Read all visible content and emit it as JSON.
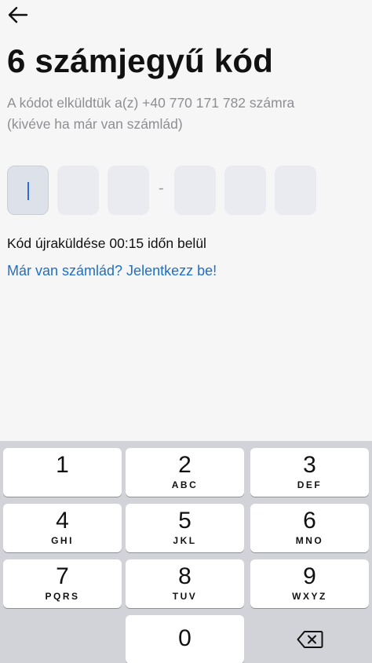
{
  "header": {
    "back_icon": "arrow-left-icon",
    "title": "6 számjegyű kód",
    "subtitle_line1": "A kódot elküldtük a(z) +40 770 171 782 számra",
    "subtitle_line2": "(kivéve ha már van számlád)"
  },
  "code_input": {
    "separator": "-",
    "digits": [
      "",
      "",
      "",
      "",
      "",
      ""
    ],
    "active_index": 0
  },
  "resend_text": "Kód újraküldése 00:15 időn belül",
  "login_link": "Már van számlád? Jelentkezz be!",
  "colors": {
    "accent": "#1f6fc6",
    "caret": "#2b6fd6",
    "background": "#f6f6f7",
    "keypad": "#d1d3d9"
  },
  "keypad": {
    "keys": [
      {
        "num": "1",
        "letters": ""
      },
      {
        "num": "2",
        "letters": "ABC"
      },
      {
        "num": "3",
        "letters": "DEF"
      },
      {
        "num": "4",
        "letters": "GHI"
      },
      {
        "num": "5",
        "letters": "JKL"
      },
      {
        "num": "6",
        "letters": "MNO"
      },
      {
        "num": "7",
        "letters": "PQRS"
      },
      {
        "num": "8",
        "letters": "TUV"
      },
      {
        "num": "9",
        "letters": "WXYZ"
      },
      {
        "num": "0",
        "letters": ""
      }
    ],
    "delete_icon": "backspace-icon"
  }
}
